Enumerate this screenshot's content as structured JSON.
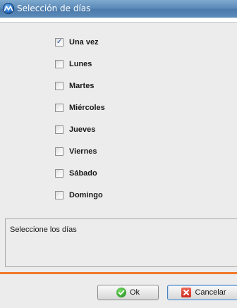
{
  "window": {
    "title": "Selección de días"
  },
  "options": [
    {
      "label": "Una vez",
      "checked": true
    },
    {
      "label": "Lunes",
      "checked": false
    },
    {
      "label": "Martes",
      "checked": false
    },
    {
      "label": "Miércoles",
      "checked": false
    },
    {
      "label": "Jueves",
      "checked": false
    },
    {
      "label": "Viernes",
      "checked": false
    },
    {
      "label": "Sábado",
      "checked": false
    },
    {
      "label": "Domingo",
      "checked": false
    }
  ],
  "status": {
    "text": "Seleccione los días"
  },
  "buttons": {
    "ok_label": "Ok",
    "cancel_label": "Cancelar"
  },
  "icons": {
    "app": "app-logo-icon",
    "ok": "check-circle-icon",
    "cancel": "close-square-icon"
  },
  "colors": {
    "title_bar": "#5b8bb9",
    "accent_line": "#f07a2a",
    "check_mark": "#21439b"
  }
}
